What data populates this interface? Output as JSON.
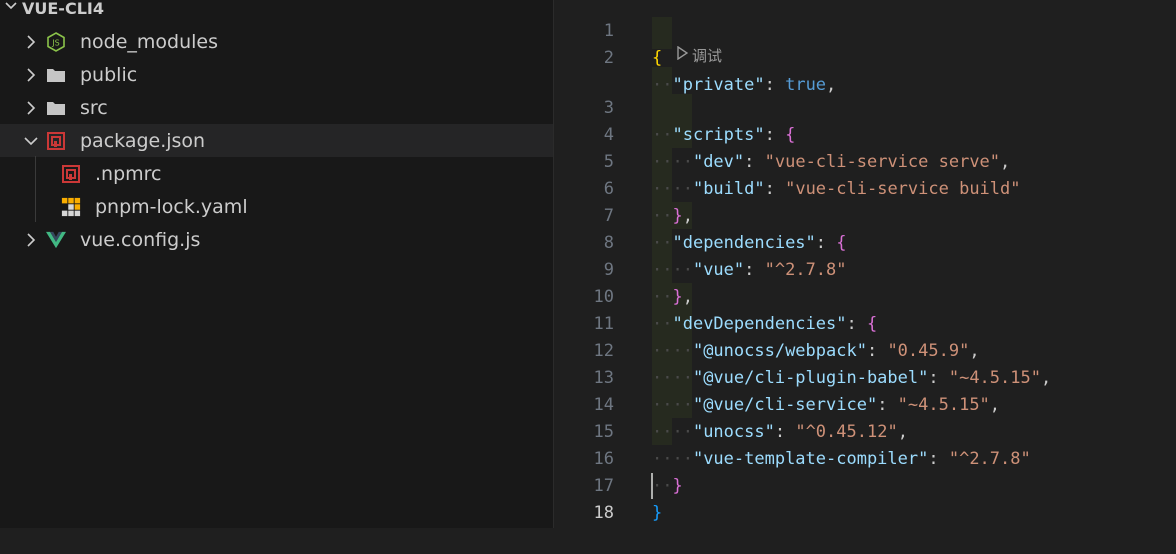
{
  "explorer": {
    "folder_name": "VUE-CLI4",
    "items": [
      {
        "label": "node_modules",
        "icon": "nodejs-folder-icon"
      },
      {
        "label": "public",
        "icon": "folder-icon"
      },
      {
        "label": "src",
        "icon": "folder-icon"
      },
      {
        "label": "package.json",
        "icon": "npm-icon"
      },
      {
        "label": ".npmrc",
        "icon": "npm-icon"
      },
      {
        "label": "pnpm-lock.yaml",
        "icon": "pnpm-icon"
      },
      {
        "label": "vue.config.js",
        "icon": "vue-icon"
      }
    ]
  },
  "editor": {
    "codelens_label": "调试",
    "line_numbers": [
      "1",
      "2",
      "3",
      "4",
      "5",
      "6",
      "7",
      "8",
      "9",
      "10",
      "11",
      "12",
      "13",
      "14",
      "15",
      "16",
      "17",
      "18"
    ],
    "tokens": {
      "private_key": "\"private\"",
      "true_val": "true",
      "scripts_key": "\"scripts\"",
      "dev_key": "\"dev\"",
      "dev_val": "\"vue-cli-service serve\"",
      "build_key": "\"build\"",
      "build_val": "\"vue-cli-service build\"",
      "deps_key": "\"dependencies\"",
      "vue_key": "\"vue\"",
      "vue_val": "\"^2.7.8\"",
      "devdeps_key": "\"devDependencies\"",
      "unocss_webpack_key": "\"@unocss/webpack\"",
      "unocss_webpack_val": "\"0.45.9\"",
      "babel_key": "\"@vue/cli-plugin-babel\"",
      "babel_val": "\"~4.5.15\"",
      "service_key": "\"@vue/cli-service\"",
      "service_val": "\"~4.5.15\"",
      "unocss_key": "\"unocss\"",
      "unocss_val": "\"^0.45.12\"",
      "compiler_key": "\"vue-template-compiler\"",
      "compiler_val": "\"^2.7.8\""
    }
  }
}
